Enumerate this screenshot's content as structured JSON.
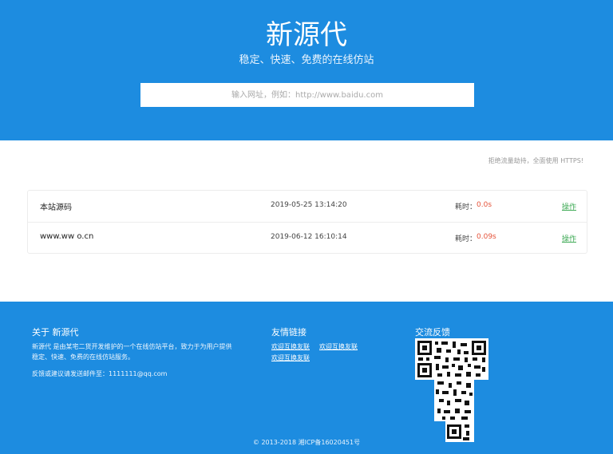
{
  "hero": {
    "title": "新源代",
    "subtitle": "稳定、快速、免费的在线仿站",
    "search_placeholder": "输入网址，例如：http://www.baidu.com"
  },
  "notice": "拒绝流量劫持，全面使用 HTTPS!",
  "records": [
    {
      "name": "本站源码",
      "time": "2019-05-25 13:14:20",
      "cost_label": "耗时：",
      "cost": "0.0s",
      "action": "操作"
    },
    {
      "name": "www.ww   o.cn",
      "time": "2019-06-12 16:10:14",
      "cost_label": "耗时：",
      "cost": "0.09s",
      "action": "操作"
    }
  ],
  "footer": {
    "about_title": "关于 新源代",
    "about_text_1": "新源代 是由某宅二货开发维护的一个在线仿站平台，致力于为用户提供",
    "about_text_2": "稳定、快速、免费的在线仿站服务。",
    "contact_text": "反馈或建议请发送邮件至：1111111@qq.com",
    "links_title": "友情链接",
    "links": [
      "欢迎互换友联",
      "欢迎互换友联",
      "欢迎互换友联"
    ],
    "feedback_title": "交流反馈",
    "copyright": "© 2013-2018 湘ICP备16020451号"
  },
  "colors": {
    "brand_blue": "#1d8ce0",
    "cost_red": "#e5533a",
    "action_green": "#3eaa55"
  },
  "icons": {
    "qr": "qr-code-icon"
  }
}
